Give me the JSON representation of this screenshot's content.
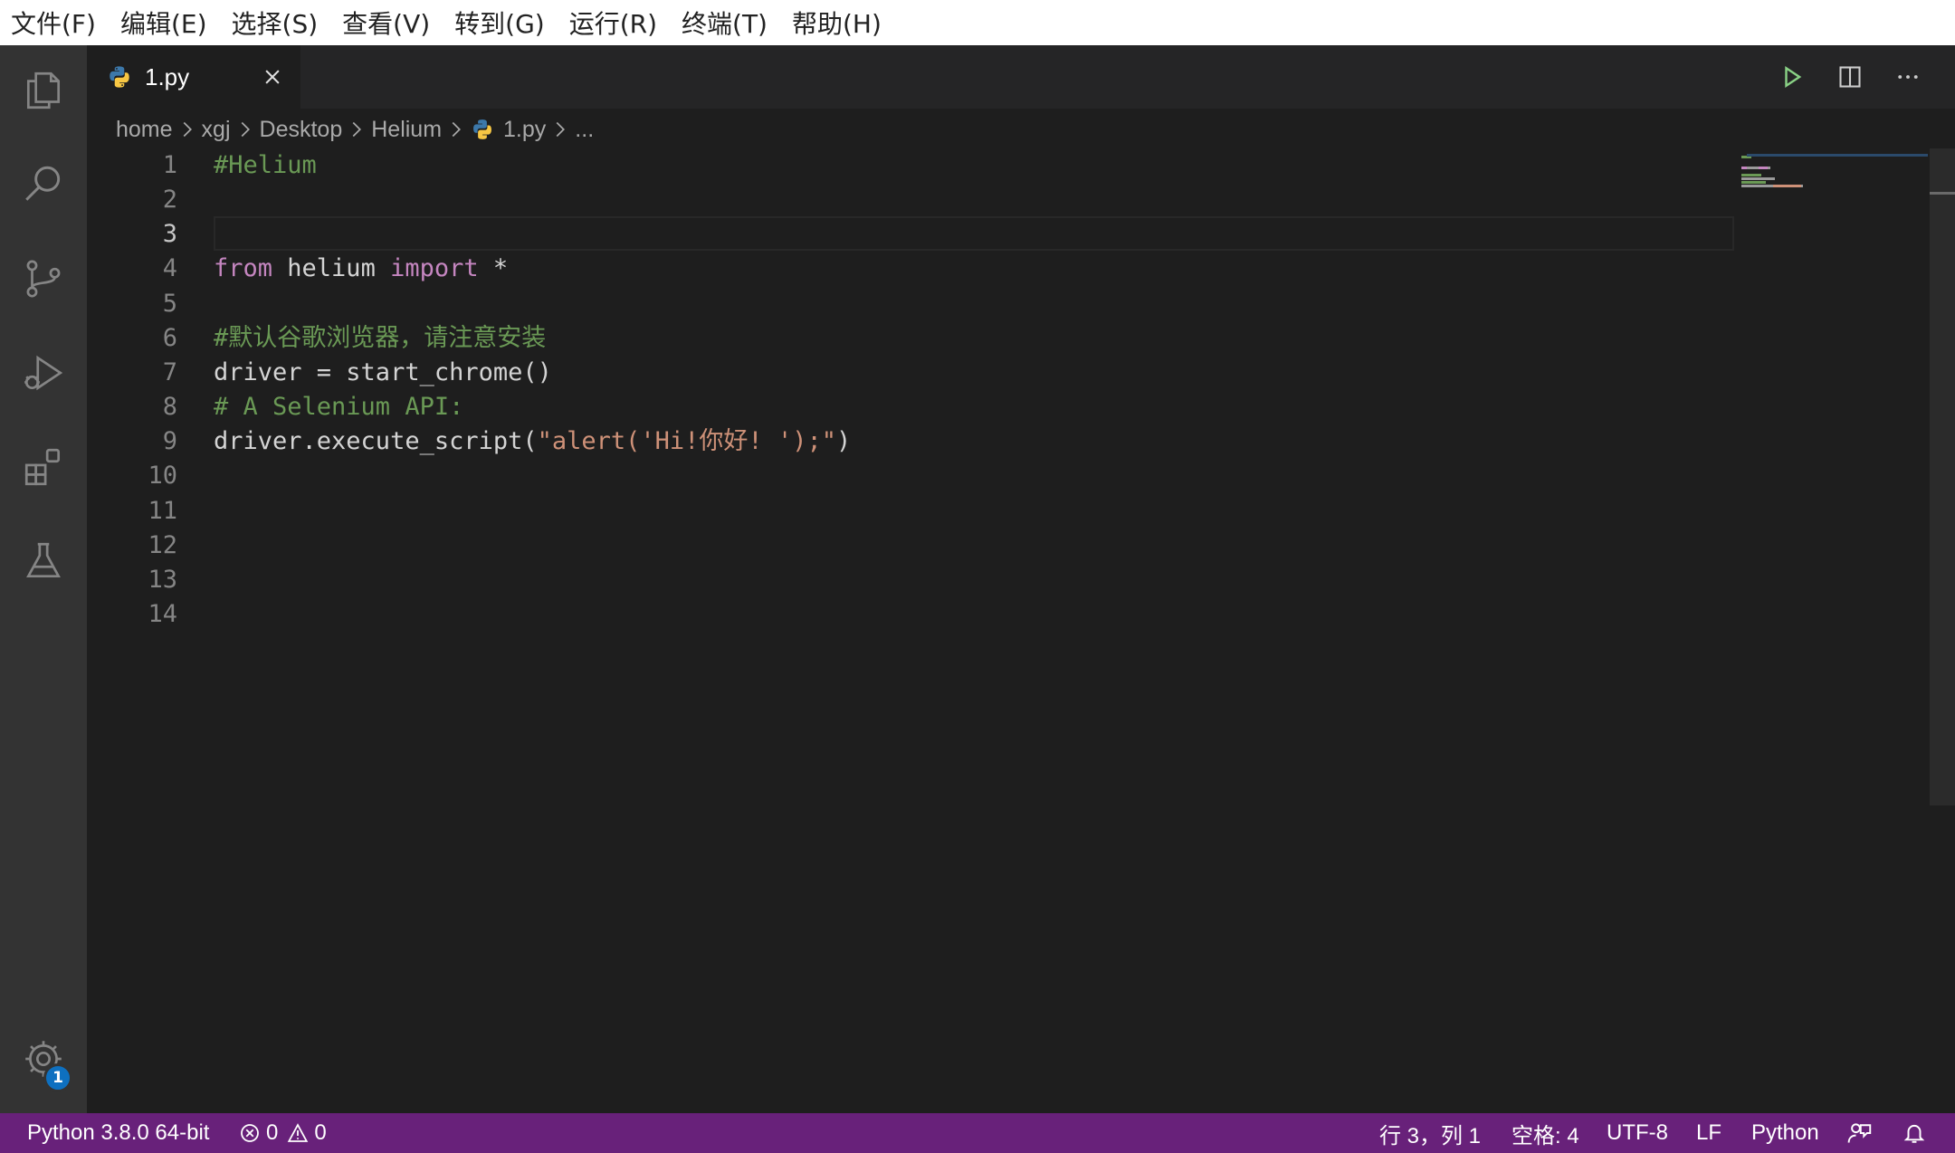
{
  "menu": [
    "文件(F)",
    "编辑(E)",
    "选择(S)",
    "查看(V)",
    "转到(G)",
    "运行(R)",
    "终端(T)",
    "帮助(H)"
  ],
  "activity_bar": {
    "items": [
      "explorer-icon",
      "search-icon",
      "source-control-icon",
      "run-debug-icon",
      "extensions-icon",
      "testing-icon"
    ],
    "settings_badge": "1"
  },
  "tab": {
    "label": "1.py",
    "language_icon": "python-icon"
  },
  "toolbar": [
    "run-icon",
    "split-editor-icon",
    "more-actions-icon"
  ],
  "breadcrumb": {
    "segments": [
      "home",
      "xgj",
      "Desktop",
      "Helium"
    ],
    "file": "1.py",
    "trailing": "..."
  },
  "editor": {
    "active_line": 3,
    "line_numbers": [
      "1",
      "2",
      "3",
      "4",
      "5",
      "6",
      "7",
      "8",
      "9",
      "10",
      "11",
      "12",
      "13",
      "14"
    ],
    "lines": [
      [
        {
          "t": "#Helium",
          "c": "comment"
        }
      ],
      [],
      [],
      [
        {
          "t": "from",
          "c": "keyword"
        },
        {
          "t": " helium ",
          "c": "plain"
        },
        {
          "t": "import",
          "c": "keyword"
        },
        {
          "t": " *",
          "c": "plain"
        }
      ],
      [],
      [
        {
          "t": "#默认谷歌浏览器，请注意安装",
          "c": "comment"
        }
      ],
      [
        {
          "t": "driver = start_chrome()",
          "c": "plain"
        }
      ],
      [
        {
          "t": "# A Selenium API:",
          "c": "comment"
        }
      ],
      [
        {
          "t": "driver.execute_script(",
          "c": "plain"
        },
        {
          "t": "\"alert('Hi!你好! ');\"",
          "c": "string"
        },
        {
          "t": ")",
          "c": "plain"
        }
      ],
      [],
      [],
      [],
      [],
      []
    ]
  },
  "status_bar": {
    "interpreter": "Python 3.8.0 64-bit",
    "errors": "0",
    "warnings": "0",
    "position": "行 3，列 1",
    "indent": "空格: 4",
    "encoding": "UTF-8",
    "eol": "LF",
    "language": "Python"
  },
  "colors": {
    "menubar": "#ffffff",
    "activity_bar": "#333333",
    "editor_bg": "#1e1e1e",
    "status_bar": "#68217a",
    "comment": "#6a9955",
    "keyword": "#c586c0",
    "string": "#ce9178",
    "badge": "#0e70c0"
  }
}
